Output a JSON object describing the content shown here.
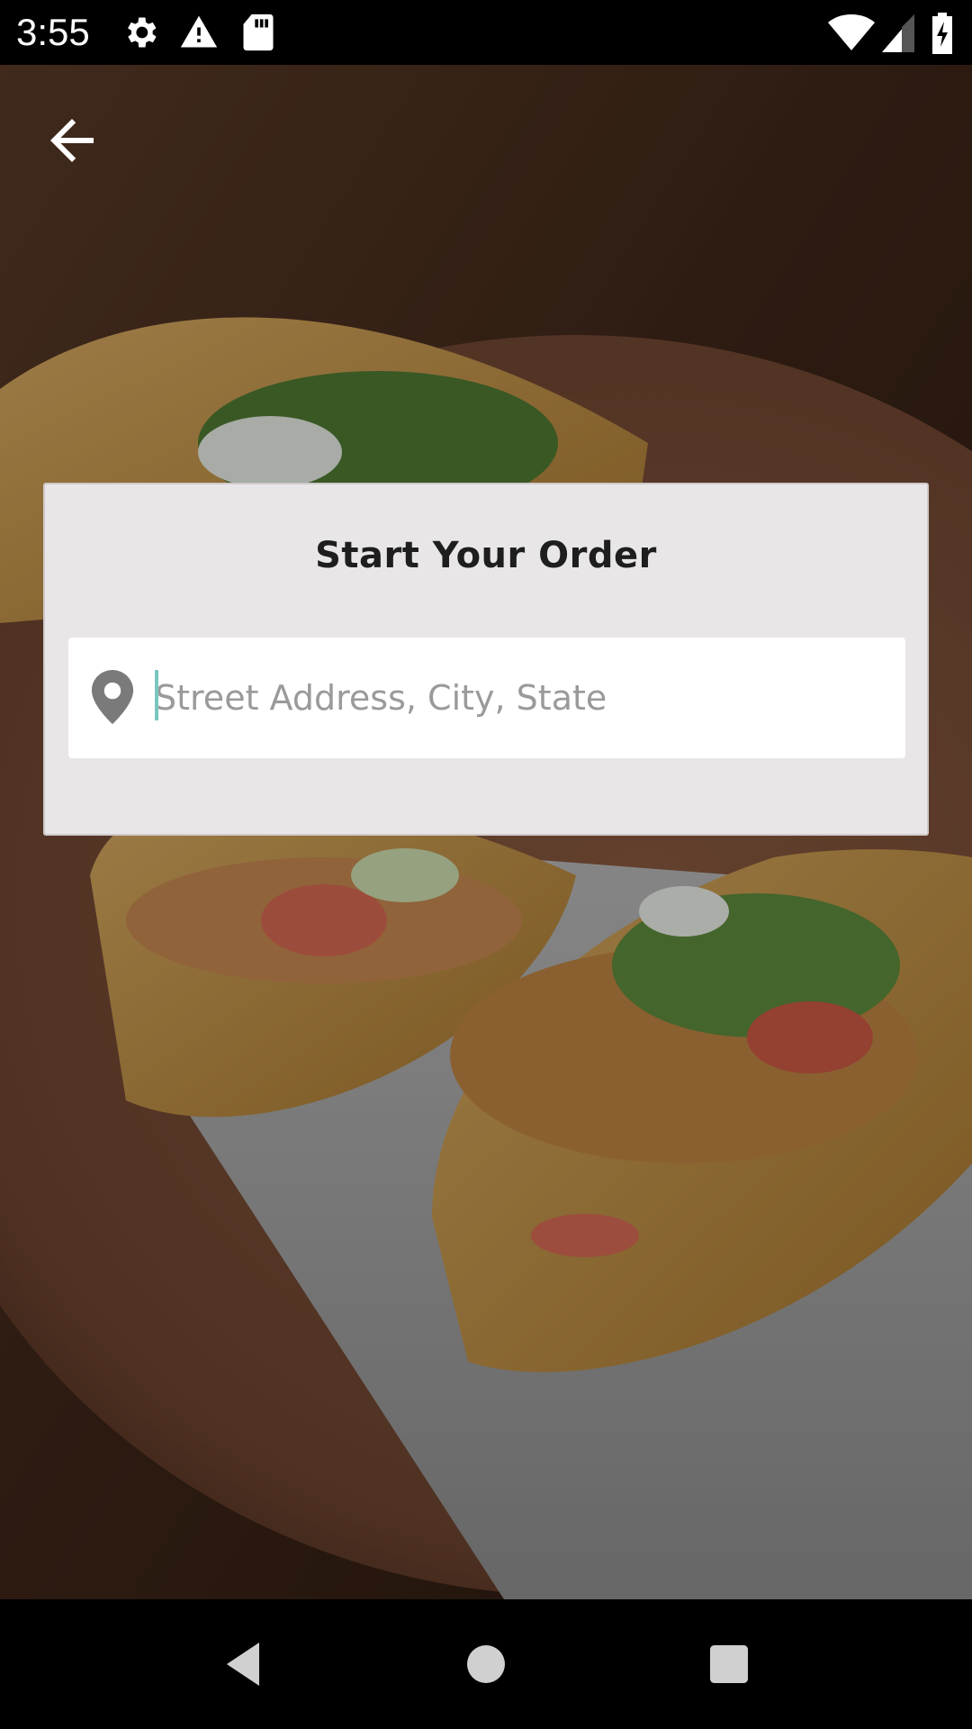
{
  "status_bar": {
    "time": "3:55",
    "left_icons": [
      "settings-gear-icon",
      "warning-icon",
      "sd-card-icon"
    ],
    "right_icons": [
      "wifi-icon",
      "cellular-signal-icon",
      "battery-charging-icon"
    ]
  },
  "header": {
    "back_icon": "arrow-left-icon"
  },
  "order_card": {
    "title": "Start Your Order",
    "address_input": {
      "placeholder": "Street Address, City, State",
      "value": "",
      "icon": "location-pin-icon"
    }
  },
  "nav_bar": {
    "buttons": [
      "back-triangle-icon",
      "home-circle-icon",
      "recents-square-icon"
    ]
  },
  "colors": {
    "card_background": "#e9e6e7",
    "input_background": "#ffffff",
    "caret": "#7ac7c0",
    "title_text": "#1e1e1e",
    "placeholder_text": "#9a9a9a"
  }
}
